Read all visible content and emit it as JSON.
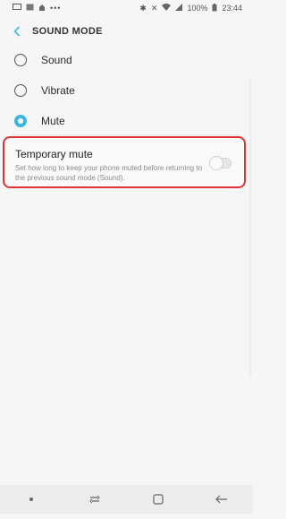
{
  "status": {
    "left_icons": [
      "cast-icon",
      "image-icon",
      "notification-icon"
    ],
    "battery": "100%",
    "time": "23:44"
  },
  "toolbar": {
    "title": "SOUND MODE"
  },
  "options": [
    {
      "label": "Sound",
      "selected": false
    },
    {
      "label": "Vibrate",
      "selected": false
    },
    {
      "label": "Mute",
      "selected": true
    }
  ],
  "temporary_mute": {
    "title": "Temporary mute",
    "description": "Set how long to keep your phone muted before returning to the previous sound mode (Sound).",
    "enabled": false
  },
  "colors": {
    "accent": "#3fb6e0",
    "highlight": "#dd3333"
  }
}
